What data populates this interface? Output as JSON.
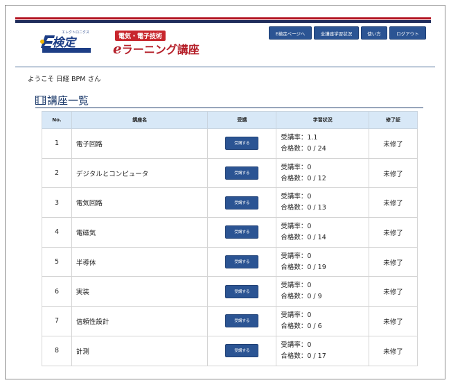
{
  "header": {
    "logo_text": "検定",
    "logo_small": "エレクトロニクス",
    "category_label": "電気・電子技術",
    "site_title_e": "e",
    "site_title": "ラーニング講座"
  },
  "nav": [
    {
      "label": "E検定ページへ",
      "width": 62
    },
    {
      "label": "全講座学習状況",
      "width": 65
    },
    {
      "label": "使い方",
      "width": 38
    },
    {
      "label": "ログアウト",
      "width": 53
    }
  ],
  "welcome": "ようこそ 日経 BPM さん",
  "section_title": "講座一覧",
  "table": {
    "headers": {
      "no": "No.",
      "name": "講座名",
      "take": "受講",
      "status": "学習状況",
      "cert": "修了証"
    },
    "rows": [
      {
        "no": "1",
        "name": "電子回路",
        "button": "受講する",
        "rate": "受講率：1.1",
        "passed": "合格数：0 / 24",
        "cert": "未修了"
      },
      {
        "no": "2",
        "name": "デジタルとコンピュータ",
        "button": "受講する",
        "rate": "受講率：0",
        "passed": "合格数：0 / 12",
        "cert": "未修了"
      },
      {
        "no": "3",
        "name": "電気回路",
        "button": "受講する",
        "rate": "受講率：0",
        "passed": "合格数：0 / 13",
        "cert": "未修了"
      },
      {
        "no": "4",
        "name": "電磁気",
        "button": "受講する",
        "rate": "受講率：0",
        "passed": "合格数：0 / 14",
        "cert": "未修了"
      },
      {
        "no": "5",
        "name": "半導体",
        "button": "受講する",
        "rate": "受講率：0",
        "passed": "合格数：0 / 19",
        "cert": "未修了"
      },
      {
        "no": "6",
        "name": "実装",
        "button": "受講する",
        "rate": "受講率：0",
        "passed": "合格数：0 / 9",
        "cert": "未修了"
      },
      {
        "no": "7",
        "name": "信頼性設計",
        "button": "受講する",
        "rate": "受講率：0",
        "passed": "合格数：0 / 6",
        "cert": "未修了"
      },
      {
        "no": "8",
        "name": "計測",
        "button": "受講する",
        "rate": "受講率：0",
        "passed": "合格数：0 / 17",
        "cert": "未修了"
      }
    ]
  },
  "colors": {
    "brand_red": "#b00f1e",
    "navy": "#1f2d5c",
    "button_blue": "#2b5493",
    "header_bg": "#d8e8f7"
  }
}
